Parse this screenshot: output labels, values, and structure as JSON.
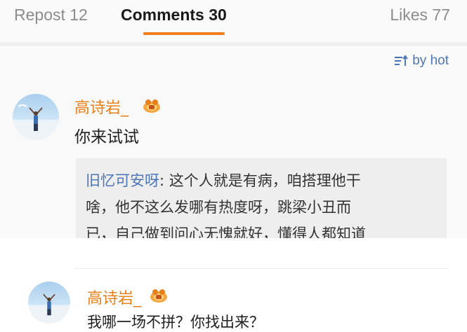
{
  "tabs": {
    "repost": "Repost 12",
    "comments": "Comments 30",
    "likes": "Likes 77"
  },
  "sort": {
    "label": "by hot",
    "icon": "sort-hot-icon"
  },
  "colors": {
    "accent": "#f07e1c",
    "username": "#e8801b",
    "link": "#4d76b8"
  },
  "comments": [
    {
      "user": "高诗岩_",
      "text": "你来试试",
      "quote": {
        "name": "旧忆可安呀",
        "lines": [
          ": 这个人就是有病，咱搭理他干",
          "啥，他不这么发哪有热度呀，跳梁小丑而",
          "已，自己做到问心无愧就好，懂得人都知道"
        ]
      }
    },
    {
      "user": "高诗岩_",
      "text": "我哪一场不拼？你找出来？"
    }
  ]
}
